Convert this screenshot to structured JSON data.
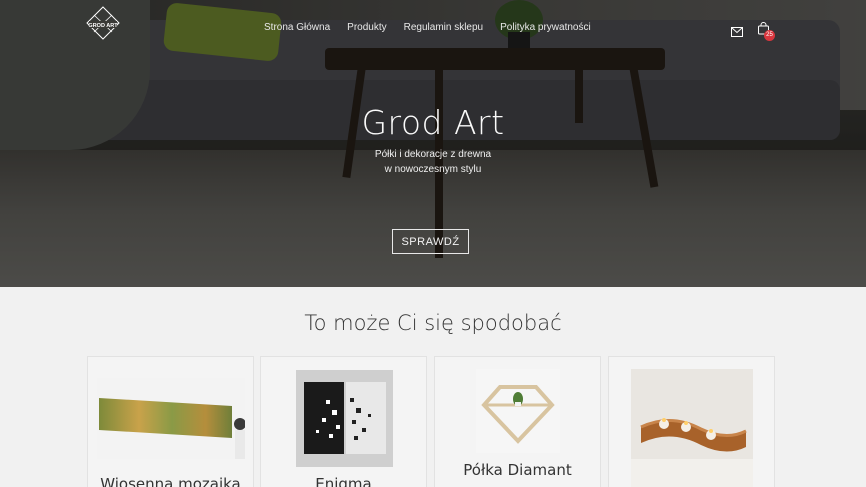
{
  "brand": {
    "logo_text": "GROD ART"
  },
  "nav": {
    "items": [
      {
        "label": "Strona Główna"
      },
      {
        "label": "Produkty"
      },
      {
        "label": "Regulamin sklepu"
      },
      {
        "label": "Polityka prywatności"
      }
    ]
  },
  "header_icons": {
    "mail": "mail-icon",
    "cart": "cart-icon",
    "cart_count": "25"
  },
  "hero": {
    "title": "Grod Art",
    "subtitle_line1": "Półki i dekoracje z drewna",
    "subtitle_line2": "w nowoczesnym stylu",
    "cta_label": "SPRAWDŹ"
  },
  "section": {
    "title": "To może Ci się spodobać"
  },
  "products": [
    {
      "name": "Wiosenna mozaika"
    },
    {
      "name": "Enigma"
    },
    {
      "name": "Półka Diamant"
    },
    {
      "name": ""
    }
  ],
  "colors": {
    "badge": "#d9363e",
    "text": "#333333",
    "background": "#f1f1f1"
  }
}
